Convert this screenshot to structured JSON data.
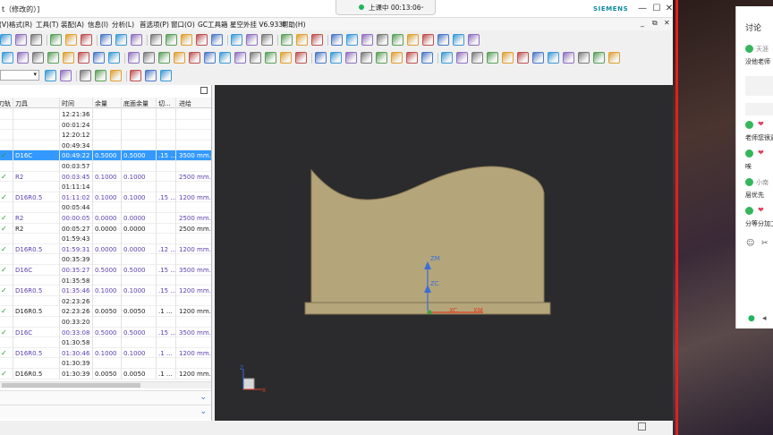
{
  "window": {
    "title": "t（修改的）]",
    "brand": "SIEMENS",
    "minimize": "—",
    "maximize": "☐",
    "close": "✕"
  },
  "menubar": {
    "items": [
      "视图(V)",
      "格式(R)",
      "工具(T)",
      "装配(A)",
      "信息(I)",
      "分析(L)",
      "首选项(P)",
      "窗口(O)",
      "GC工具箱",
      "星空外挂 V6.933F",
      "帮助(H)"
    ],
    "mdi": [
      "_",
      "⧉",
      "✕"
    ]
  },
  "meeting": {
    "status": "上课中 00:13:06",
    "chevron": "⌄"
  },
  "nav": {
    "columns": [
      "刀轨",
      "刀具",
      "时间",
      "余量",
      "底面余量",
      "切...",
      "进给"
    ],
    "rows": [
      {
        "chk": "",
        "tool": "",
        "time": "12:21:36",
        "stock": "",
        "floor": "",
        "cut": "",
        "feed": "",
        "style": "normal"
      },
      {
        "chk": "",
        "tool": "",
        "time": "00:01:24",
        "stock": "",
        "floor": "",
        "cut": "",
        "feed": "",
        "style": "normal"
      },
      {
        "chk": "",
        "tool": "",
        "time": "12:20:12",
        "stock": "",
        "floor": "",
        "cut": "",
        "feed": "",
        "style": "normal"
      },
      {
        "chk": "",
        "tool": "",
        "time": "00:49:34",
        "stock": "",
        "floor": "",
        "cut": "",
        "feed": "",
        "style": "normal"
      },
      {
        "chk": "✓",
        "tool": "D16C",
        "time": "00:49:22",
        "stock": "0.5000",
        "floor": "0.5000",
        "cut": ".15 ...",
        "feed": "3500 mm...",
        "style": "sel"
      },
      {
        "chk": "",
        "tool": "",
        "time": "00:03:57",
        "stock": "",
        "floor": "",
        "cut": "",
        "feed": "",
        "style": "normal"
      },
      {
        "chk": "✓",
        "tool": "R2",
        "time": "00:03:45",
        "stock": "0.1000",
        "floor": "0.1000",
        "cut": "",
        "feed": "2500 mm...",
        "style": "purple"
      },
      {
        "chk": "",
        "tool": "",
        "time": "01:11:14",
        "stock": "",
        "floor": "",
        "cut": "",
        "feed": "",
        "style": "normal"
      },
      {
        "chk": "✓",
        "tool": "D16R0.5",
        "time": "01:11:02",
        "stock": "0.1000",
        "floor": "0.1000",
        "cut": ".15 ...",
        "feed": "1200 mm...",
        "style": "purple"
      },
      {
        "chk": "",
        "tool": "",
        "time": "00:05:44",
        "stock": "",
        "floor": "",
        "cut": "",
        "feed": "",
        "style": "normal"
      },
      {
        "chk": "✓",
        "tool": "R2",
        "time": "00:00:05",
        "stock": "0.0000",
        "floor": "0.0000",
        "cut": "",
        "feed": "2500 mm...",
        "style": "purple"
      },
      {
        "chk": "✓",
        "tool": "R2",
        "time": "00:05:27",
        "stock": "0.0000",
        "floor": "0.0000",
        "cut": "",
        "feed": "2500 mm...",
        "style": "normal"
      },
      {
        "chk": "",
        "tool": "",
        "time": "01:59:43",
        "stock": "",
        "floor": "",
        "cut": "",
        "feed": "",
        "style": "normal"
      },
      {
        "chk": "✓",
        "tool": "D16R0.5",
        "time": "01:59:31",
        "stock": "0.0000",
        "floor": "0.0000",
        "cut": ".12 ...",
        "feed": "1200 mm...",
        "style": "purple"
      },
      {
        "chk": "",
        "tool": "",
        "time": "00:35:39",
        "stock": "",
        "floor": "",
        "cut": "",
        "feed": "",
        "style": "normal"
      },
      {
        "chk": "✓",
        "tool": "D16C",
        "time": "00:35:27",
        "stock": "0.5000",
        "floor": "0.5000",
        "cut": ".15 ...",
        "feed": "3500 mm...",
        "style": "purple"
      },
      {
        "chk": "",
        "tool": "",
        "time": "01:35:58",
        "stock": "",
        "floor": "",
        "cut": "",
        "feed": "",
        "style": "normal"
      },
      {
        "chk": "✓",
        "tool": "D16R0.5",
        "time": "01:35:46",
        "stock": "0.1000",
        "floor": "0.1000",
        "cut": ".15 ...",
        "feed": "1200 mm...",
        "style": "purple"
      },
      {
        "chk": "",
        "tool": "",
        "time": "02:23:26",
        "stock": "",
        "floor": "",
        "cut": "",
        "feed": "",
        "style": "normal"
      },
      {
        "chk": "✓",
        "tool": "D16R0.5",
        "time": "02:23:26",
        "stock": "0.0050",
        "floor": "0.0050",
        "cut": ".1 ...",
        "feed": "1200 mm...",
        "style": "normal"
      },
      {
        "chk": "",
        "tool": "",
        "time": "00:33:20",
        "stock": "",
        "floor": "",
        "cut": "",
        "feed": "",
        "style": "normal"
      },
      {
        "chk": "✓",
        "tool": "D16C",
        "time": "00:33:08",
        "stock": "0.5000",
        "floor": "0.5000",
        "cut": ".15 ...",
        "feed": "3500 mm...",
        "style": "purple"
      },
      {
        "chk": "",
        "tool": "",
        "time": "01:30:58",
        "stock": "",
        "floor": "",
        "cut": "",
        "feed": "",
        "style": "normal"
      },
      {
        "chk": "✓",
        "tool": "D16R0.5",
        "time": "01:30:46",
        "stock": "0.1000",
        "floor": "0.1000",
        "cut": ".1 ...",
        "feed": "1200 mm...",
        "style": "purple"
      },
      {
        "chk": "",
        "tool": "",
        "time": "01:30:39",
        "stock": "",
        "floor": "",
        "cut": "",
        "feed": "",
        "style": "normal"
      },
      {
        "chk": "✓",
        "tool": "D16R0.5",
        "time": "01:30:39",
        "stock": "0.0050",
        "floor": "0.0050",
        "cut": ".1 ...",
        "feed": "1200 mm...",
        "style": "normal"
      }
    ]
  },
  "viewport": {
    "background": "#2b2b2e",
    "part_color": "#b5a57a",
    "labels": {
      "zm": "ZM",
      "zc": "ZC",
      "xc": "XC",
      "xm": "XM",
      "x": "X",
      "z": "Z"
    }
  },
  "chat": {
    "title": "讨论",
    "messages": [
      {
        "name": "天涯",
        "text": "没他老师"
      },
      {
        "name": "",
        "text": "老师您很遇"
      },
      {
        "name": "",
        "text": "唉"
      },
      {
        "name": "小南",
        "text": "层优先"
      },
      {
        "name": "",
        "text": "分等分加工"
      }
    ]
  },
  "colors": {
    "selection": "#3399ff",
    "purple_row": "#5a3fb0",
    "check": "#1a9a2a",
    "brand": "#0c8aa0",
    "meeting_dot": "#1fb55d",
    "red_border": "#e02020"
  }
}
